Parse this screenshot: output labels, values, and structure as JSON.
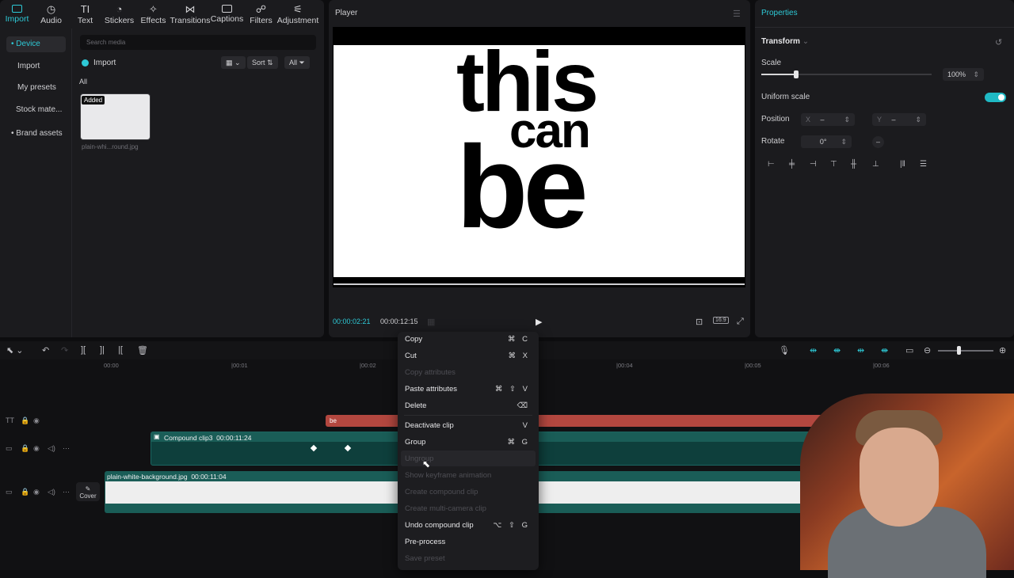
{
  "toolbar": {
    "tabs": [
      {
        "label": "Import",
        "icon": "import-icon"
      },
      {
        "label": "Audio",
        "icon": "audio-icon"
      },
      {
        "label": "Text",
        "icon": "text-icon"
      },
      {
        "label": "Stickers",
        "icon": "stickers-icon"
      },
      {
        "label": "Effects",
        "icon": "effects-icon"
      },
      {
        "label": "Transitions",
        "icon": "transitions-icon"
      },
      {
        "label": "Captions",
        "icon": "captions-icon"
      },
      {
        "label": "Filters",
        "icon": "filters-icon"
      },
      {
        "label": "Adjustment",
        "icon": "adjustment-icon"
      }
    ]
  },
  "sidebar": {
    "items": [
      "• Device",
      "Import",
      "My presets",
      "Stock mate...",
      "• Brand assets"
    ]
  },
  "media": {
    "search_placeholder": "Search media",
    "import_label": "Import",
    "sort_label": "Sort",
    "all_filter_label": "All",
    "all_heading": "All",
    "thumb_badge": "Added",
    "thumb_name": "plain-whi...round.jpg"
  },
  "player": {
    "title": "Player",
    "words": [
      "this",
      "can",
      "be"
    ],
    "time_current": "00:00:02:21",
    "time_total": "00:00:12:15",
    "ratio_label": "16:9"
  },
  "properties": {
    "title": "Properties",
    "transform_title": "Transform",
    "scale_label": "Scale",
    "scale_value": "100%",
    "uniform_scale_label": "Uniform scale",
    "uniform_scale_on": true,
    "position_label": "Position",
    "x_label": "X",
    "x_value": "–",
    "y_label": "Y",
    "y_value": "–",
    "rotate_label": "Rotate",
    "rotate_value": "0°",
    "rotate_reset": "–"
  },
  "timeline": {
    "ticks": [
      "00:00",
      "|00:01",
      "|00:02",
      "|00:04",
      "|00:05",
      "|00:06"
    ],
    "text_clip_label": "be",
    "compound_clip_label": "Compound clip3",
    "compound_clip_duration": "00:00:11:24",
    "bg_clip_label": "plain-white-background.jpg",
    "bg_clip_duration": "00:00:11:04",
    "cover_label": "Cover"
  },
  "context_menu": {
    "items": [
      {
        "label": "Copy",
        "shortcut": "⌘ C",
        "enabled": true
      },
      {
        "label": "Cut",
        "shortcut": "⌘ X",
        "enabled": true
      },
      {
        "label": "Copy attributes",
        "shortcut": "",
        "enabled": false
      },
      {
        "label": "Paste attributes",
        "shortcut": "⌘ ⇧ V",
        "enabled": true
      },
      {
        "label": "Delete",
        "shortcut": "⌫",
        "enabled": true
      },
      {
        "label": "Deactivate clip",
        "shortcut": "V",
        "enabled": true
      },
      {
        "label": "Group",
        "shortcut": "⌘ G",
        "enabled": true
      },
      {
        "label": "Ungroup",
        "shortcut": "",
        "enabled": false
      },
      {
        "label": "Show keyframe animation",
        "shortcut": "",
        "enabled": false
      },
      {
        "label": "Create compound clip",
        "shortcut": "",
        "enabled": false
      },
      {
        "label": "Create multi-camera clip",
        "shortcut": "",
        "enabled": false
      },
      {
        "label": "Undo compound clip",
        "shortcut": "⌥ ⇧ G",
        "enabled": true
      },
      {
        "label": "Pre-process",
        "shortcut": "",
        "enabled": true
      },
      {
        "label": "Save preset",
        "shortcut": "",
        "enabled": false
      }
    ]
  },
  "colors": {
    "accent": "#2ec9d6",
    "text_clip": "#b3473f",
    "video_clip": "#1a5d57"
  }
}
